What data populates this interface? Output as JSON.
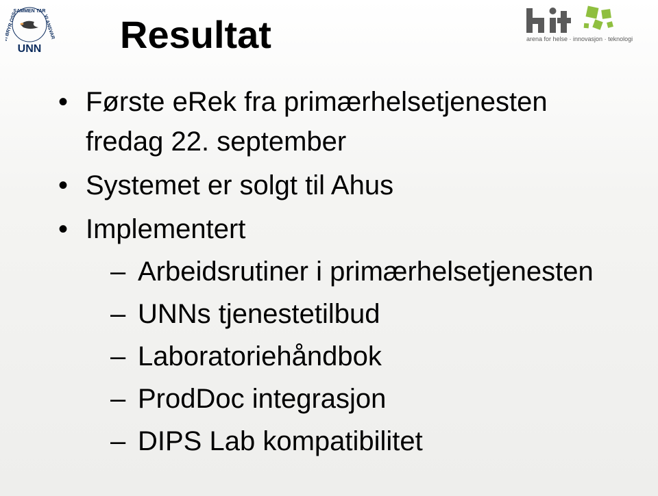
{
  "title": "Resultat",
  "logos": {
    "left_label": "UNN",
    "left_circle_top": "SAMMEN TAR",
    "left_circle_left": "VI BRYR OSS",
    "left_circle_right": "VI ANSVAR",
    "right_brand": "hit",
    "right_tagline": "arena for helse · innovasjon · teknologi"
  },
  "bullets": [
    {
      "text": "Første eRek fra primærhelsetjenesten fredag 22. september"
    },
    {
      "text": "Systemet er solgt til Ahus"
    },
    {
      "text": "Implementert",
      "children": [
        "Arbeidsrutiner i primærhelsetjenesten",
        "UNNs tjenestetilbud",
        "Laboratoriehåndbok",
        "ProdDoc integrasjon",
        "DIPS Lab kompatibilitet"
      ]
    }
  ]
}
